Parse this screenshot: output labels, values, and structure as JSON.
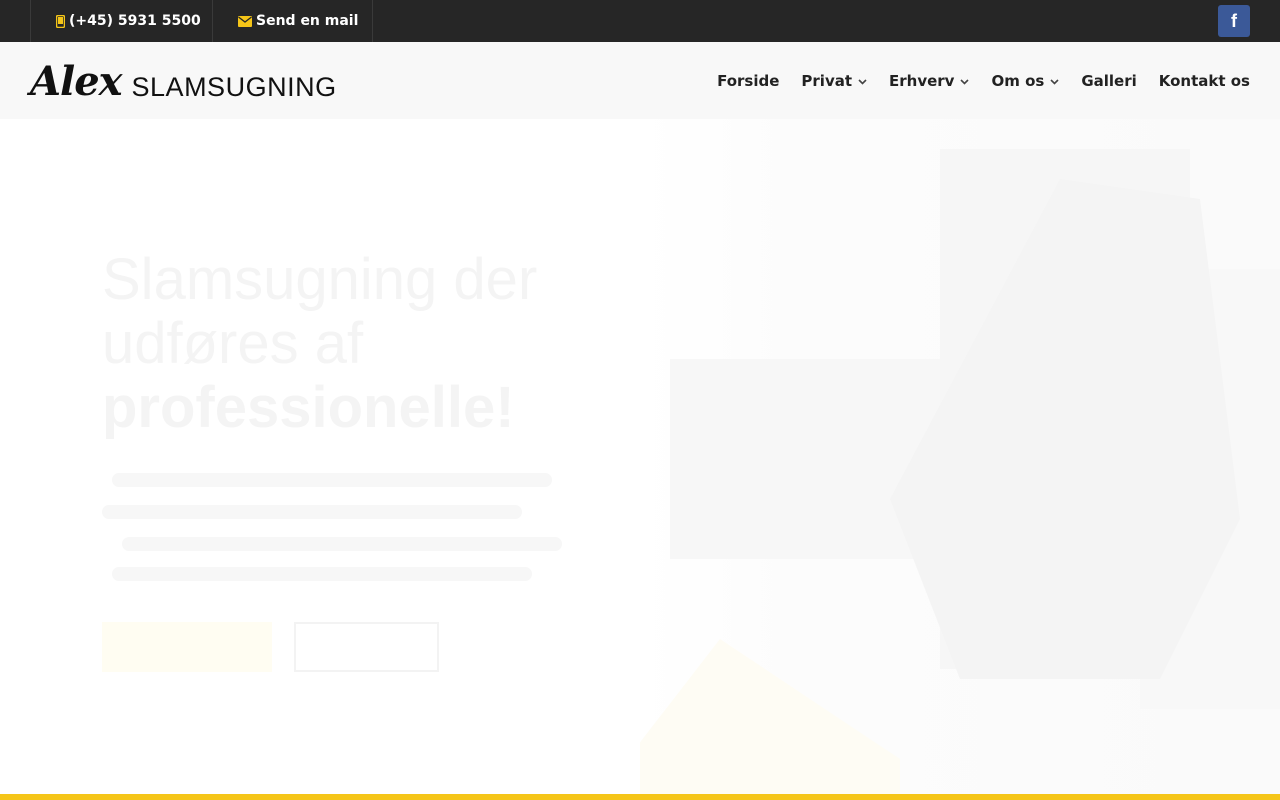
{
  "topbar": {
    "phone": "(+45) 5931 5500",
    "mail": "Send en mail",
    "facebook_icon": "facebook-icon"
  },
  "header": {
    "logo_script": "Alex",
    "logo_word": "SLAMSUGNING",
    "nav": [
      {
        "label": "Forside",
        "dropdown": false
      },
      {
        "label": "Privat",
        "dropdown": true
      },
      {
        "label": "Erhverv",
        "dropdown": true
      },
      {
        "label": "Om os",
        "dropdown": true
      },
      {
        "label": "Galleri",
        "dropdown": false
      },
      {
        "label": "Kontakt os",
        "dropdown": false
      }
    ]
  },
  "hero": {
    "heading_line1": "Slamsugning der",
    "heading_line2": "udføres af",
    "heading_line3": "professionelle!",
    "paragraph": "",
    "button_primary": "",
    "button_secondary": ""
  },
  "colors": {
    "topbar_bg": "#262626",
    "accent": "#f5c518",
    "header_bg": "#f8f8f8",
    "facebook": "#3b5998"
  }
}
